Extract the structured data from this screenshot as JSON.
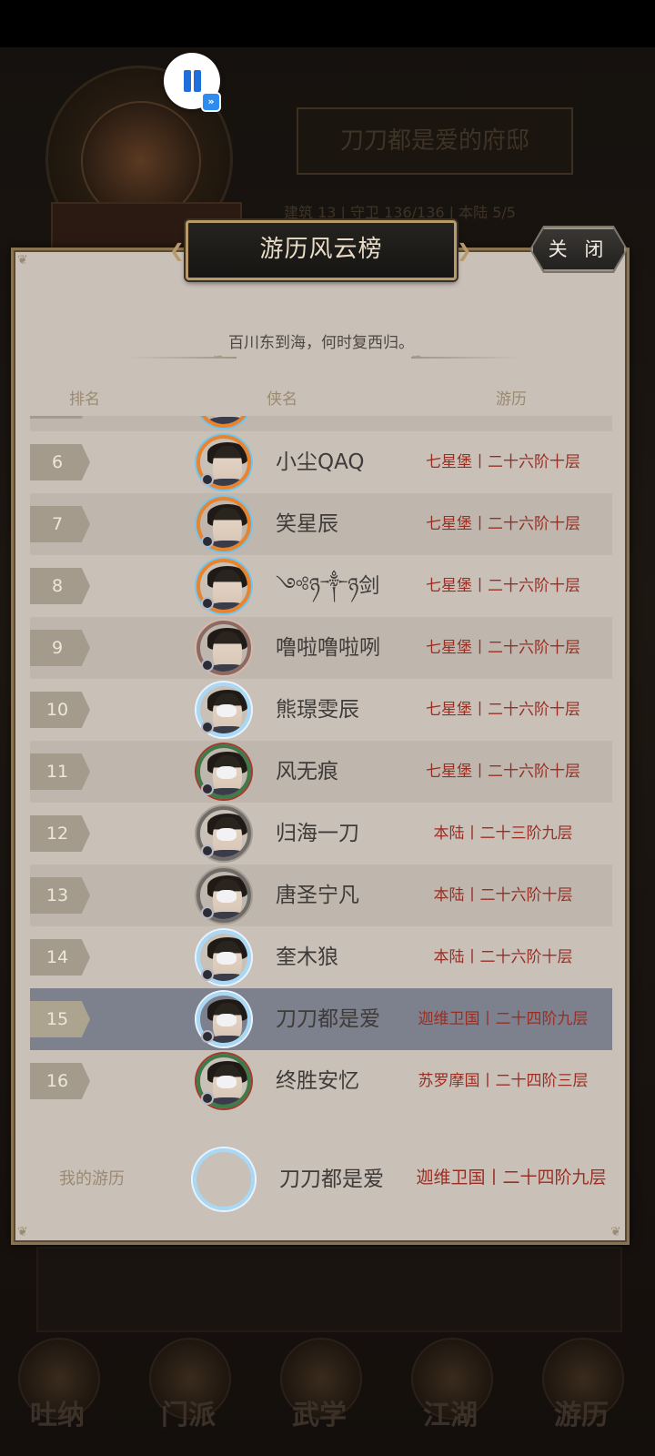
{
  "background": {
    "title": "刀刀都是爱的府邸",
    "stats": "建筑 13  |  守卫 136/136  |  本陆 5/5",
    "nav": [
      "吐纳",
      "门派",
      "武学",
      "江湖",
      "游历"
    ]
  },
  "overlay": {
    "pause_icon": "pause-icon",
    "fast_forward_icon": "fast-forward-icon"
  },
  "panel": {
    "title": "游历风云榜",
    "close_label": "关 闭",
    "subtitle": "百川东到海，何时复西归。",
    "columns": {
      "rank": "排名",
      "name": "侠名",
      "travel": "游历"
    }
  },
  "rows": [
    {
      "rank": "6",
      "name": "小尘QAQ",
      "travel": "七星堡丨二十六阶十层",
      "frame": "fire"
    },
    {
      "rank": "7",
      "name": "笑星辰",
      "travel": "七星堡丨二十六阶十层",
      "frame": "fire"
    },
    {
      "rank": "8",
      "name": "༺ཉ༒ཉ剑",
      "travel": "七星堡丨二十六阶十层",
      "frame": "fire"
    },
    {
      "rank": "9",
      "name": "噜啦噜啦咧",
      "travel": "七星堡丨二十六阶十层",
      "frame": "rose"
    },
    {
      "rank": "10",
      "name": "熊璟雯辰",
      "travel": "七星堡丨二十六阶十层",
      "frame": "ice"
    },
    {
      "rank": "11",
      "name": "风无痕",
      "travel": "七星堡丨二十六阶十层",
      "frame": "jade"
    },
    {
      "rank": "12",
      "name": "归海一刀",
      "travel": "本陆丨二十三阶九层",
      "frame": "plain"
    },
    {
      "rank": "13",
      "name": "唐圣宁凡",
      "travel": "本陆丨二十六阶十层",
      "frame": "plain"
    },
    {
      "rank": "14",
      "name": "奎木狼",
      "travel": "本陆丨二十六阶十层",
      "frame": "ice"
    },
    {
      "rank": "15",
      "name": "刀刀都是爱",
      "travel": "迦维卫国丨二十四阶九层",
      "frame": "ice",
      "highlight": true
    },
    {
      "rank": "16",
      "name": "终胜安忆",
      "travel": "苏罗摩国丨二十四阶三层",
      "frame": "jade"
    }
  ],
  "my_record": {
    "label": "我的游历",
    "name": "刀刀都是爱",
    "travel": "迦维卫国丨二十四阶九层"
  },
  "colors": {
    "travel_text": "#9a2e23",
    "highlight_row": "#7d808d",
    "panel_bg": "#c9c0b8"
  }
}
